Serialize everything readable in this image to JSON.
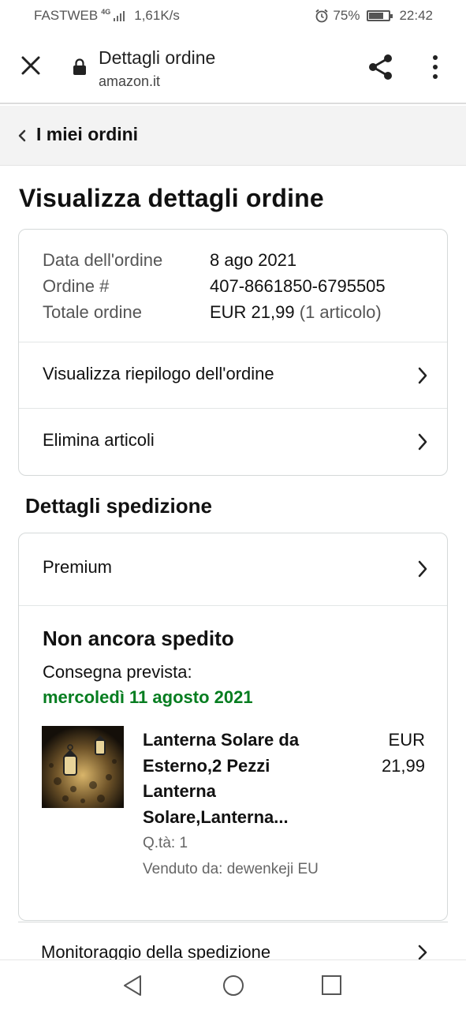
{
  "status_bar": {
    "carrier": "FASTWEB",
    "network_badge": "4G",
    "speed": "1,61K/s",
    "battery": "75%",
    "battery_level": 0.75,
    "time": "22:42",
    "icons": [
      "signal-icon",
      "alarm-icon",
      "battery-icon"
    ]
  },
  "browser": {
    "title": "Dettagli ordine",
    "url": "amazon.it",
    "icons": [
      "close-icon",
      "lock-icon",
      "share-icon",
      "more-vert-icon"
    ]
  },
  "breadcrumb": {
    "label": "I miei ordini"
  },
  "page_title": "Visualizza dettagli ordine",
  "order_summary": {
    "date_label": "Data dell'ordine",
    "date_value": "8 ago 2021",
    "number_label": "Ordine #",
    "number_value": "407-8661850-6795505",
    "total_label": "Totale ordine",
    "total_value": "EUR 21,99",
    "total_items": "(1 articolo)",
    "links": [
      {
        "label": "Visualizza riepilogo dell'ordine"
      },
      {
        "label": "Elimina articoli"
      }
    ]
  },
  "shipping": {
    "section_title": "Dettagli spedizione",
    "method": "Premium",
    "status": "Non ancora spedito",
    "delivery_label": "Consegna prevista:",
    "delivery_date": "mercoledì 11 agosto 2021",
    "delivery_color": "#067d20",
    "item": {
      "title": "Lanterna Solare da Esterno,2 Pezzi Lanterna Solare,Lanterna...",
      "price": "EUR 21,99",
      "qty": "Q.tà: 1",
      "seller": "Venduto da: dewenkeji EU"
    },
    "tracking_label": "Monitoraggio della spedizione"
  },
  "nav_bar": {
    "icons": [
      "back-icon",
      "home-icon",
      "recent-apps-icon"
    ]
  }
}
